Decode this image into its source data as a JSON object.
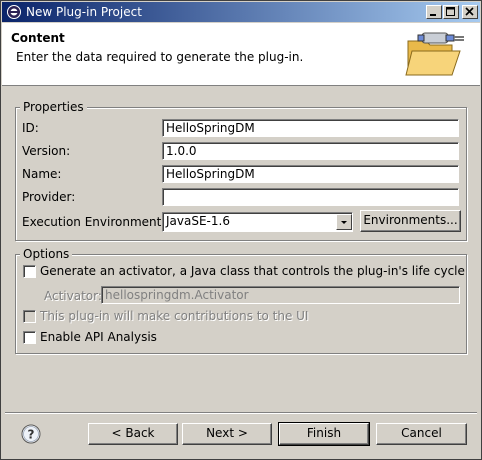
{
  "window": {
    "title": "New Plug-in Project",
    "controls": [
      "minimize-icon",
      "maximize-icon",
      "close-icon"
    ]
  },
  "header": {
    "title": "Content",
    "description": "Enter the data required to generate the plug-in."
  },
  "properties": {
    "group_label": "Properties",
    "id": {
      "label": "ID:",
      "value": "HelloSpringDM"
    },
    "version": {
      "label": "Version:",
      "value": "1.0.0"
    },
    "name": {
      "label": "Name:",
      "value": "HelloSpringDM"
    },
    "provider": {
      "label": "Provider:",
      "value": ""
    },
    "execution_env": {
      "label": "Execution Environment:",
      "value": "JavaSE-1.6"
    },
    "environments_button": "Environments..."
  },
  "options": {
    "group_label": "Options",
    "generate_activator": {
      "label": "Generate an activator, a Java class that controls the plug-in's life cycle",
      "checked": false
    },
    "activator": {
      "label": "Activator:",
      "value": "hellospringdm.Activator",
      "enabled": false
    },
    "ui_contrib": {
      "label": "This plug-in will make contributions to the UI",
      "checked": false,
      "enabled": false
    },
    "api_analysis": {
      "label": "Enable API Analysis",
      "checked": false
    }
  },
  "footer": {
    "help_icon": "help-icon",
    "back": "< Back",
    "next": "Next >",
    "finish": "Finish",
    "cancel": "Cancel"
  }
}
